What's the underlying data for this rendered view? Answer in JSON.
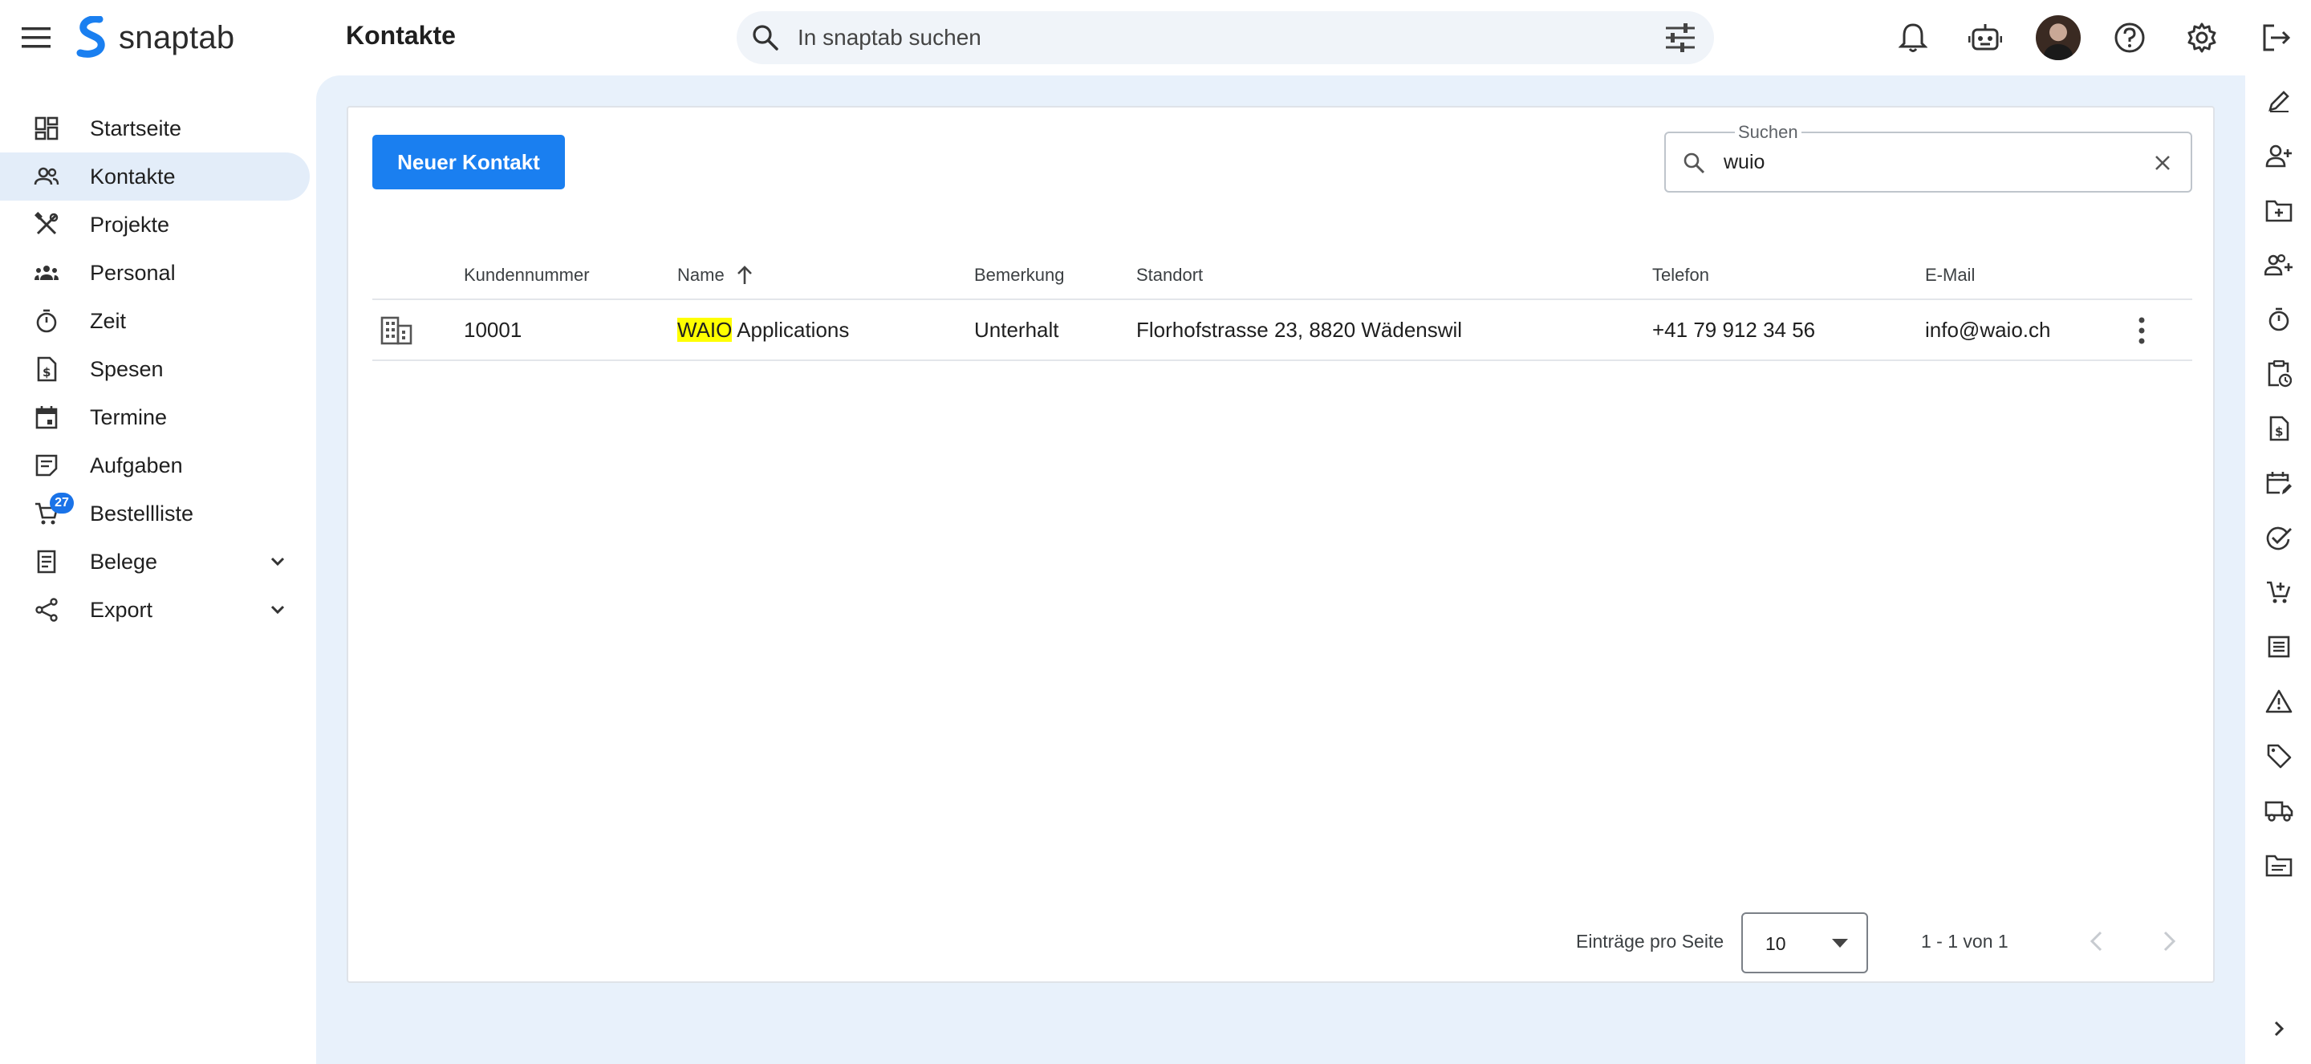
{
  "app": {
    "name": "snaptab"
  },
  "header": {
    "page_title": "Kontakte",
    "search_placeholder": "In snaptab suchen"
  },
  "sidebar": {
    "items": [
      {
        "label": "Startseite",
        "icon": "dashboard-icon"
      },
      {
        "label": "Kontakte",
        "icon": "contacts-icon",
        "active": true
      },
      {
        "label": "Projekte",
        "icon": "tools-icon"
      },
      {
        "label": "Personal",
        "icon": "groups-icon"
      },
      {
        "label": "Zeit",
        "icon": "timer-icon"
      },
      {
        "label": "Spesen",
        "icon": "receipt-dollar-icon"
      },
      {
        "label": "Termine",
        "icon": "calendar-icon"
      },
      {
        "label": "Aufgaben",
        "icon": "task-note-icon"
      },
      {
        "label": "Bestellliste",
        "icon": "cart-icon",
        "badge": "27"
      },
      {
        "label": "Belege",
        "icon": "document-icon",
        "expandable": true
      },
      {
        "label": "Export",
        "icon": "share-icon",
        "expandable": true
      }
    ]
  },
  "main": {
    "new_button": "Neuer Kontakt",
    "search": {
      "label": "Suchen",
      "value": "wuio"
    },
    "table": {
      "columns": [
        "Kundennummer",
        "Name",
        "Bemerkung",
        "Standort",
        "Telefon",
        "E-Mail"
      ],
      "sorted_column": "Name",
      "sort_direction": "asc",
      "rows": [
        {
          "type_icon": "building-icon",
          "kundennummer": "10001",
          "name_highlight": "WAIO",
          "name_rest": " Applications",
          "bemerkung": "Unterhalt",
          "standort": "Florhofstrasse 23, 8820 Wädenswil",
          "telefon": "+41 79 912 34 56",
          "email": "info@waio.ch"
        }
      ]
    },
    "pagination": {
      "label": "Einträge pro Seite",
      "page_size": "10",
      "range": "1 - 1 von 1"
    }
  },
  "colors": {
    "accent": "#1a7ff0",
    "active_nav": "#e3edf9",
    "main_background": "#e8f1fb",
    "highlight": "#ffff00",
    "badge": "#1a73e8"
  },
  "rail_icons": [
    "edit-icon",
    "person-add-icon",
    "folder-add-icon",
    "group-add-icon",
    "timer-icon",
    "clipboard-clock-icon",
    "receipt-dollar-icon",
    "calendar-edit-icon",
    "check-circle-icon",
    "cart-add-icon",
    "list-icon",
    "warning-icon",
    "tag-icon",
    "truck-icon",
    "folder-icon",
    "chevron-right-icon"
  ]
}
